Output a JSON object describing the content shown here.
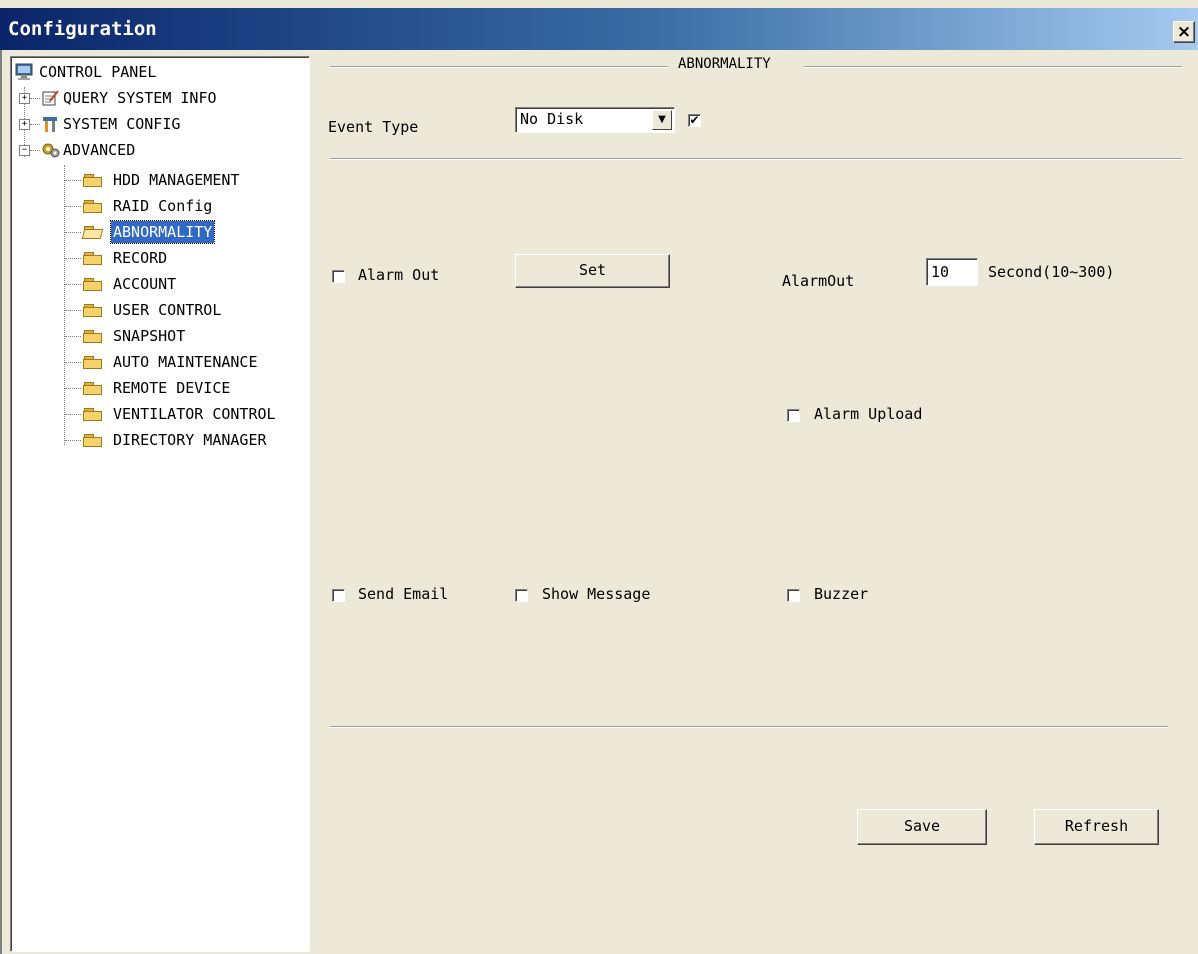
{
  "window": {
    "title": "Configuration",
    "close_glyph": "×"
  },
  "tree": {
    "root": {
      "label": "CONTROL PANEL",
      "icon": "monitor-icon"
    },
    "nodes": [
      {
        "label": "QUERY SYSTEM INFO",
        "icon": "notepad-icon",
        "expander": "+"
      },
      {
        "label": "SYSTEM CONFIG",
        "icon": "tools-icon",
        "expander": "+"
      },
      {
        "label": "ADVANCED",
        "icon": "gears-icon",
        "expander": "−"
      }
    ],
    "advanced_children": [
      {
        "label": "HDD MANAGEMENT"
      },
      {
        "label": "RAID Config"
      },
      {
        "label": "ABNORMALITY",
        "selected": true
      },
      {
        "label": "RECORD"
      },
      {
        "label": "ACCOUNT"
      },
      {
        "label": "USER CONTROL"
      },
      {
        "label": "SNAPSHOT"
      },
      {
        "label": "AUTO MAINTENANCE"
      },
      {
        "label": "REMOTE DEVICE"
      },
      {
        "label": "VENTILATOR CONTROL"
      },
      {
        "label": "DIRECTORY MANAGER"
      }
    ]
  },
  "panel": {
    "group_title": "ABNORMALITY",
    "event_type_label": "Event Type",
    "event_type_value": "No Disk",
    "event_enable_checked": "✔",
    "alarm_out_label": "Alarm Out",
    "set_button": "Set",
    "alarmout_label": "AlarmOut",
    "alarmout_value": "10",
    "alarmout_unit": "Second(10~300)",
    "alarm_upload_label": "Alarm Upload",
    "send_email_label": "Send Email",
    "show_message_label": "Show Message",
    "buzzer_label": "Buzzer",
    "save_button": "Save",
    "refresh_button": "Refresh"
  },
  "colors": {
    "face": "#ece9d8",
    "title_start": "#0a246a",
    "title_end": "#a6caf0",
    "selection": "#316ac5"
  }
}
